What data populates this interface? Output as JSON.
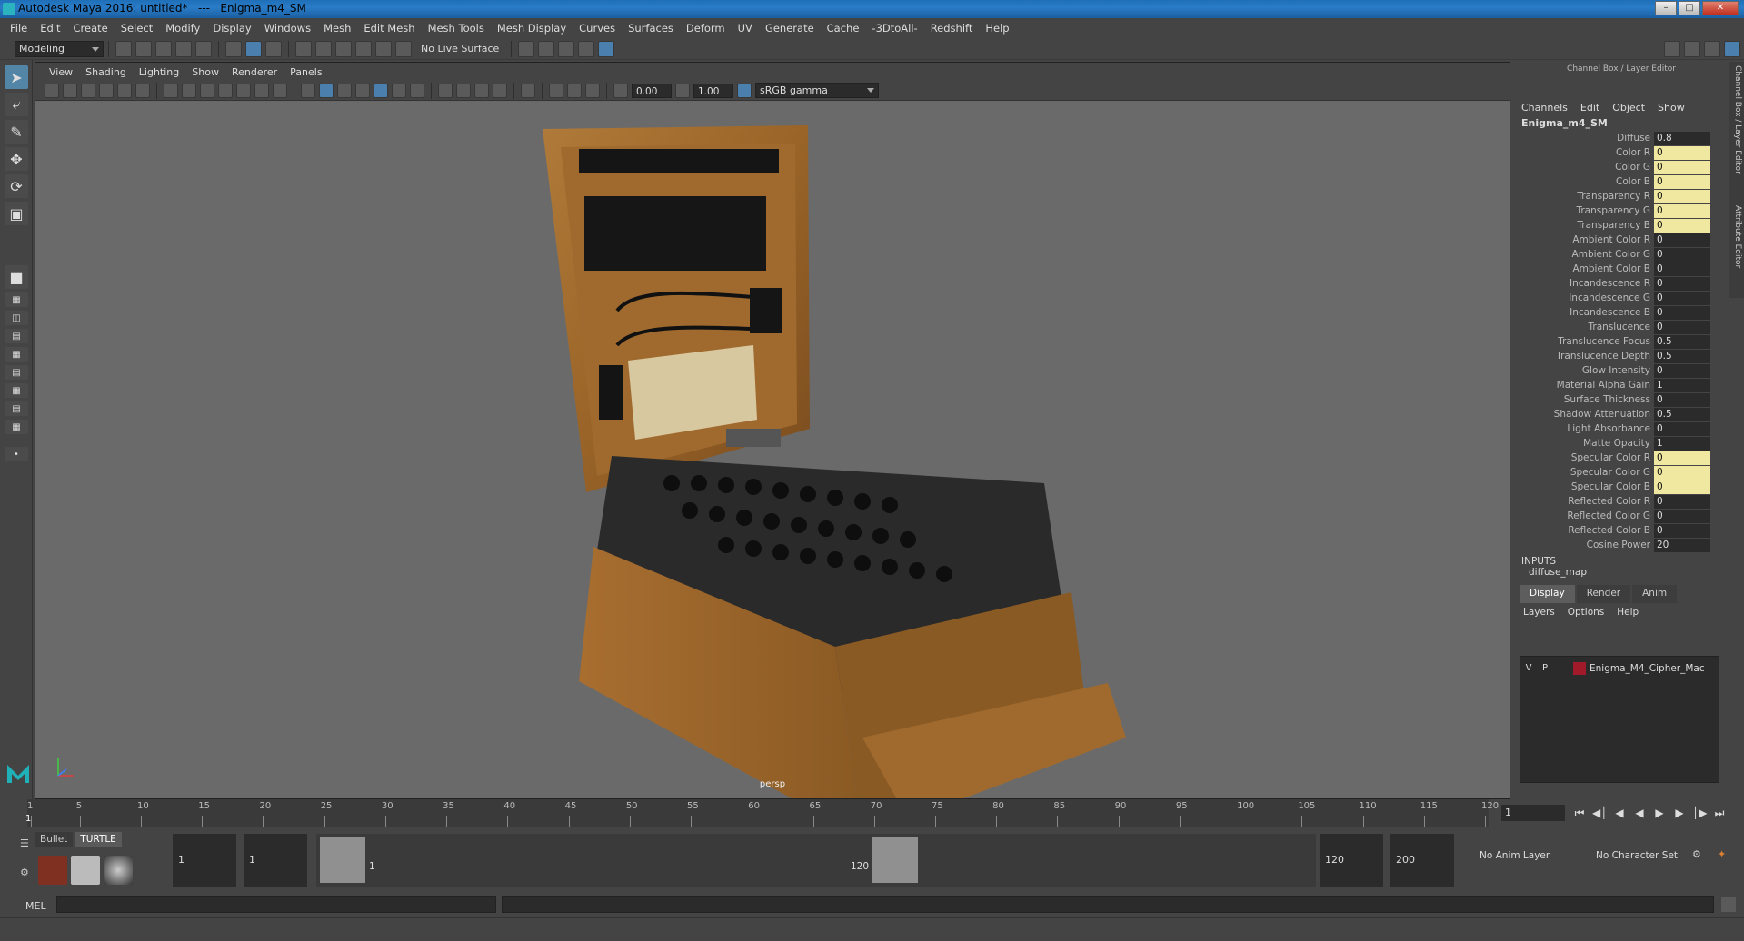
{
  "window": {
    "title": "Autodesk Maya 2016: untitled*   ---   Enigma_m4_SM"
  },
  "menubar": [
    "File",
    "Edit",
    "Create",
    "Select",
    "Modify",
    "Display",
    "Windows",
    "Mesh",
    "Edit Mesh",
    "Mesh Tools",
    "Mesh Display",
    "Curves",
    "Surfaces",
    "Deform",
    "UV",
    "Generate",
    "Cache",
    "-3DtoAll-",
    "Redshift",
    "Help"
  ],
  "statusline": {
    "mode": "Modeling",
    "live_surface": "No Live Surface"
  },
  "panel": {
    "menus": [
      "View",
      "Shading",
      "Lighting",
      "Show",
      "Renderer",
      "Panels"
    ],
    "exposure": "0.00",
    "gamma": "1.00",
    "color_space": "sRGB gamma",
    "camera": "persp"
  },
  "channel_box": {
    "header": "Channel Box / Layer Editor",
    "menus": [
      "Channels",
      "Edit",
      "Object",
      "Show"
    ],
    "object": "Enigma_m4_SM",
    "attributes": [
      {
        "label": "Diffuse",
        "value": "0.8",
        "keyed": false
      },
      {
        "label": "Color R",
        "value": "0",
        "keyed": true
      },
      {
        "label": "Color G",
        "value": "0",
        "keyed": true
      },
      {
        "label": "Color B",
        "value": "0",
        "keyed": true
      },
      {
        "label": "Transparency R",
        "value": "0",
        "keyed": true
      },
      {
        "label": "Transparency G",
        "value": "0",
        "keyed": true
      },
      {
        "label": "Transparency B",
        "value": "0",
        "keyed": true
      },
      {
        "label": "Ambient Color R",
        "value": "0",
        "keyed": false
      },
      {
        "label": "Ambient Color G",
        "value": "0",
        "keyed": false
      },
      {
        "label": "Ambient Color B",
        "value": "0",
        "keyed": false
      },
      {
        "label": "Incandescence R",
        "value": "0",
        "keyed": false
      },
      {
        "label": "Incandescence G",
        "value": "0",
        "keyed": false
      },
      {
        "label": "Incandescence B",
        "value": "0",
        "keyed": false
      },
      {
        "label": "Translucence",
        "value": "0",
        "keyed": false
      },
      {
        "label": "Translucence Focus",
        "value": "0.5",
        "keyed": false
      },
      {
        "label": "Translucence Depth",
        "value": "0.5",
        "keyed": false
      },
      {
        "label": "Glow Intensity",
        "value": "0",
        "keyed": false
      },
      {
        "label": "Material Alpha Gain",
        "value": "1",
        "keyed": false
      },
      {
        "label": "Surface Thickness",
        "value": "0",
        "keyed": false
      },
      {
        "label": "Shadow Attenuation",
        "value": "0.5",
        "keyed": false
      },
      {
        "label": "Light Absorbance",
        "value": "0",
        "keyed": false
      },
      {
        "label": "Matte Opacity",
        "value": "1",
        "keyed": false
      },
      {
        "label": "Specular Color R",
        "value": "0",
        "keyed": true
      },
      {
        "label": "Specular Color G",
        "value": "0",
        "keyed": true
      },
      {
        "label": "Specular Color B",
        "value": "0",
        "keyed": true
      },
      {
        "label": "Reflected Color R",
        "value": "0",
        "keyed": false
      },
      {
        "label": "Reflected Color G",
        "value": "0",
        "keyed": false
      },
      {
        "label": "Reflected Color B",
        "value": "0",
        "keyed": false
      },
      {
        "label": "Cosine Power",
        "value": "20",
        "keyed": false
      }
    ],
    "inputs_label": "INPUTS",
    "input_item": "diffuse_map",
    "side_tabs": [
      "Channel Box / Layer Editor",
      "Attribute Editor"
    ]
  },
  "layer_editor": {
    "tabs": [
      "Display",
      "Render",
      "Anim"
    ],
    "active_tab": "Display",
    "menus": [
      "Layers",
      "Options",
      "Help"
    ],
    "layer": {
      "v": "V",
      "p": "P",
      "name": "Enigma_M4_Cipher_Mac",
      "color": "#a01a2a"
    }
  },
  "timeline": {
    "ticks": [
      1,
      5,
      10,
      15,
      20,
      25,
      30,
      35,
      40,
      45,
      50,
      55,
      60,
      65,
      70,
      75,
      80,
      85,
      90,
      95,
      100,
      105,
      110,
      115,
      120
    ],
    "current_frame": "1",
    "start": 1,
    "end": 120
  },
  "range": {
    "shelf_tabs": [
      "Bullet",
      "TURTLE"
    ],
    "start_field": "1",
    "inner_start": "1",
    "inner_start_label": "1",
    "inner_end_label": "120",
    "end_field": "120",
    "max_field": "200",
    "anim_layer": "No Anim Layer",
    "character_set": "No Character Set"
  },
  "cmdline": {
    "label": "MEL"
  }
}
